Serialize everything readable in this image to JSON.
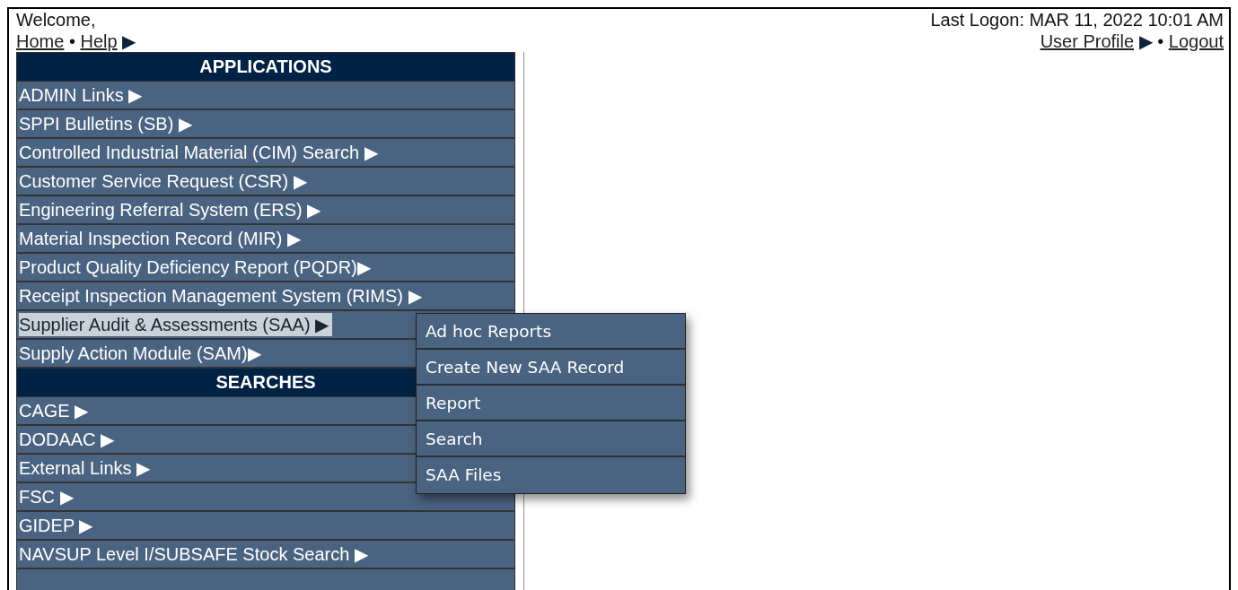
{
  "header": {
    "welcome": "Welcome,",
    "last_logon": "Last Logon: MAR 11, 2022 10:01 AM",
    "left_links": [
      {
        "kind": "link",
        "text": "Home"
      },
      {
        "kind": "sep",
        "text": "•"
      },
      {
        "kind": "link",
        "text": "Help"
      },
      {
        "kind": "arrow",
        "text": "▶"
      }
    ],
    "right_links": [
      {
        "kind": "link",
        "text": "User Profile"
      },
      {
        "kind": "arrow",
        "text": "▶"
      },
      {
        "kind": "sep",
        "text": "•"
      },
      {
        "kind": "link",
        "text": "Logout"
      }
    ]
  },
  "menu": [
    {
      "kind": "heading",
      "text": "APPLICATIONS"
    },
    {
      "kind": "item",
      "text": "ADMIN Links ▶",
      "selected": false
    },
    {
      "kind": "item",
      "text": "SPPI Bulletins (SB) ▶",
      "selected": false
    },
    {
      "kind": "item",
      "text": "Controlled Industrial Material (CIM) Search ▶",
      "selected": false
    },
    {
      "kind": "item",
      "text": "Customer Service Request (CSR) ▶",
      "selected": false
    },
    {
      "kind": "item",
      "text": "Engineering Referral System (ERS) ▶",
      "selected": false
    },
    {
      "kind": "item",
      "text": "Material Inspection Record (MIR) ▶",
      "selected": false
    },
    {
      "kind": "item",
      "text": "Product Quality Deficiency Report (PQDR)▶",
      "selected": false
    },
    {
      "kind": "item",
      "text": "Receipt Inspection Management System (RIMS) ▶",
      "selected": false
    },
    {
      "kind": "item",
      "text": "Supplier Audit & Assessments (SAA) ▶",
      "selected": true,
      "submenu": [
        "Ad hoc Reports",
        "Create New SAA Record",
        "Report",
        "Search",
        "SAA Files"
      ]
    },
    {
      "kind": "item",
      "text": "Supply Action Module (SAM)▶",
      "selected": false
    },
    {
      "kind": "heading",
      "text": "SEARCHES"
    },
    {
      "kind": "item",
      "text": "CAGE ▶",
      "selected": false
    },
    {
      "kind": "item",
      "text": "DODAAC ▶",
      "selected": false
    },
    {
      "kind": "item",
      "text": "External Links ▶",
      "selected": false
    },
    {
      "kind": "item",
      "text": "FSC ▶",
      "selected": false
    },
    {
      "kind": "item",
      "text": "GIDEP ▶",
      "selected": false
    },
    {
      "kind": "item",
      "text": "NAVSUP Level I/SUBSAFE Stock Search ▶",
      "selected": false
    },
    {
      "kind": "cut"
    }
  ]
}
